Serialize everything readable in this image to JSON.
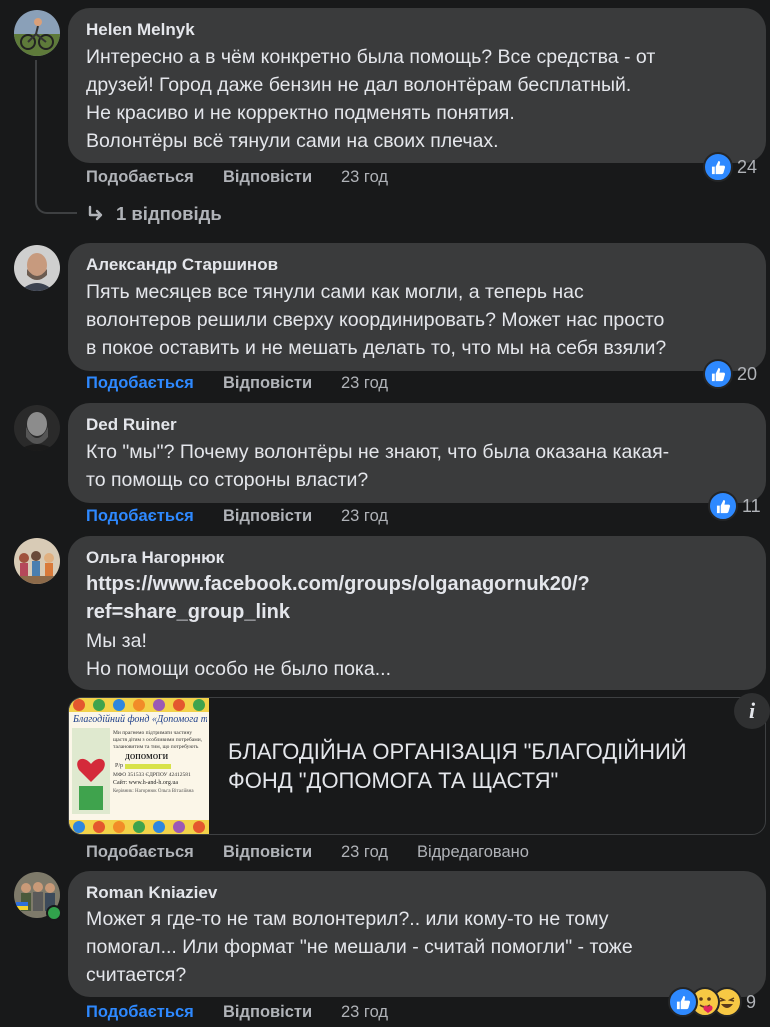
{
  "comments": [
    {
      "author": "Helen Melnyk",
      "lines": [
        "Интересно а в чём конкретно была помощь? Все средства - от",
        "друзей! Город даже бензин не дал волонтёрам бесплатный.",
        "Не красиво и не корректно подменять понятия.",
        "Волонтёры всё тянули сами на своих плечах."
      ],
      "like_label": "Подобається",
      "reply_label": "Відповісти",
      "time": "23 год",
      "reactions": "24",
      "liked": false
    },
    {
      "author": "Александр Старшинов",
      "lines": [
        "Пять месяцев все тянули сами как могли, а теперь нас",
        "волонтеров решили сверху координировать? Может нас просто",
        "в покое оставить и не мешать делать то, что мы на себя взяли?"
      ],
      "like_label": "Подобається",
      "reply_label": "Відповісти",
      "time": "23 год",
      "reactions": "20",
      "liked": true
    },
    {
      "author": "Ded Ruiner",
      "lines": [
        "Кто \"мы\"? Почему волонтёры не знают, что была оказана какая-",
        "то помощь со стороны власти?"
      ],
      "like_label": "Подобається",
      "reply_label": "Відповісти",
      "time": "23 год",
      "reactions": "11",
      "liked": true
    },
    {
      "author": "Ольга Нагорнюк",
      "lines": [
        "Мы за!",
        "Но помощи особо не было пока..."
      ],
      "link_lines": [
        "https://www.facebook.com/groups/olganagornuk20/?",
        "ref=share_group_link"
      ],
      "like_label": "Подобається",
      "reply_label": "Відповісти",
      "time": "23 год",
      "edited": "Відредаговано",
      "liked": true
    },
    {
      "author": "Roman Kniaziev",
      "lines": [
        "Может я где-то не там волонтерил?.. или кому-то не тому",
        "помогал... Или формат \"не мешали - считай помогли\" - тоже",
        "считается?"
      ],
      "like_label": "Подобається",
      "reply_label": "Відповісти",
      "time": "23 год",
      "reactions": "9",
      "liked": true
    }
  ],
  "replies_toggle": "1 відповідь",
  "link_preview": {
    "title_lines": [
      "БЛАГОДІЙНА ОРГАНІЗАЦІЯ \"БЛАГОДІЙНИЙ",
      "ФОНД \"ДОПОМОГА ТА ЩАСТЯ\""
    ],
    "thumb": {
      "heading": "Благодійний фонд «Допомога та Щастя»",
      "body": [
        "Ми прагнемо підтримати частину",
        "щастя дітям з особливими потребами,",
        "талановитим та тим, що потребують"
      ],
      "caption": "ДОПОМОГИ",
      "account": "Р/р",
      "codes": "МФО 351533     ЄДРПОУ 42412581",
      "site": "Сайт: www.h-and-h.org.ua",
      "head": "Керівник: Нагорнюк Ольга Віталіївна"
    },
    "info_glyph": "i"
  },
  "colors": {
    "background": "#18191a",
    "bubble": "#3a3b3c",
    "accent": "#2e89ff",
    "muted": "#b0b3b8",
    "text": "#e4e6eb"
  },
  "icons": [
    "reply-arrow-icon",
    "like-icon",
    "care-emoji-icon",
    "haha-emoji-icon",
    "info-icon"
  ]
}
